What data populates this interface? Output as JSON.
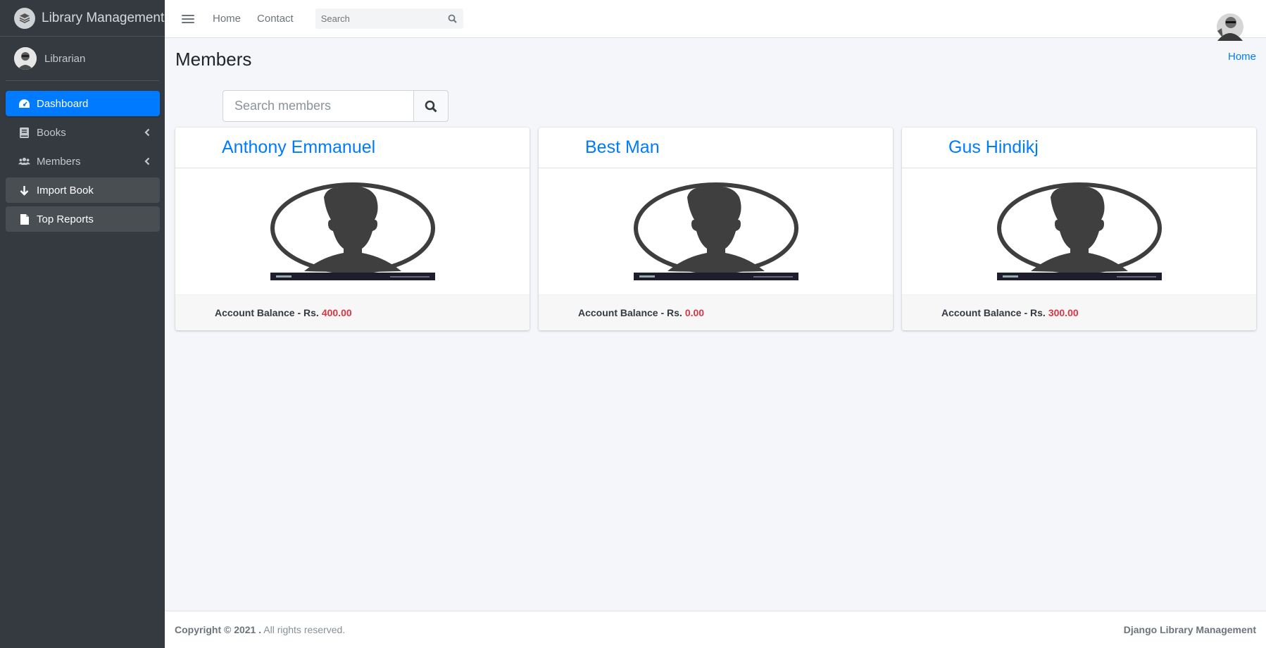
{
  "app": {
    "brand": "Library Management"
  },
  "sidebar": {
    "user": "Librarian",
    "items": [
      {
        "label": "Dashboard",
        "icon": "tachometer-icon",
        "active": true
      },
      {
        "label": "Books",
        "icon": "book-icon",
        "has_children": true
      },
      {
        "label": "Members",
        "icon": "users-icon",
        "has_children": true
      },
      {
        "label": "Import Book",
        "icon": "arrow-down-icon"
      },
      {
        "label": "Top Reports",
        "icon": "file-icon"
      }
    ]
  },
  "topbar": {
    "links": [
      "Home",
      "Contact"
    ],
    "search_placeholder": "Search"
  },
  "page": {
    "title": "Members",
    "breadcrumb": "Home",
    "search_placeholder": "Search members"
  },
  "members": [
    {
      "name": "Anthony Emmanuel",
      "balance_label": "Account Balance - Rs.",
      "balance": "400.00"
    },
    {
      "name": "Best Man",
      "balance_label": "Account Balance - Rs.",
      "balance": "0.00"
    },
    {
      "name": "Gus Hindikj",
      "balance_label": "Account Balance - Rs.",
      "balance": "300.00"
    }
  ],
  "footer": {
    "copyright": "Copyright © 2021 .",
    "rights": "All rights reserved.",
    "right": "Django Library Management"
  },
  "colors": {
    "primary": "#007bff",
    "sidebar": "#343a40",
    "danger": "#dc3545"
  }
}
